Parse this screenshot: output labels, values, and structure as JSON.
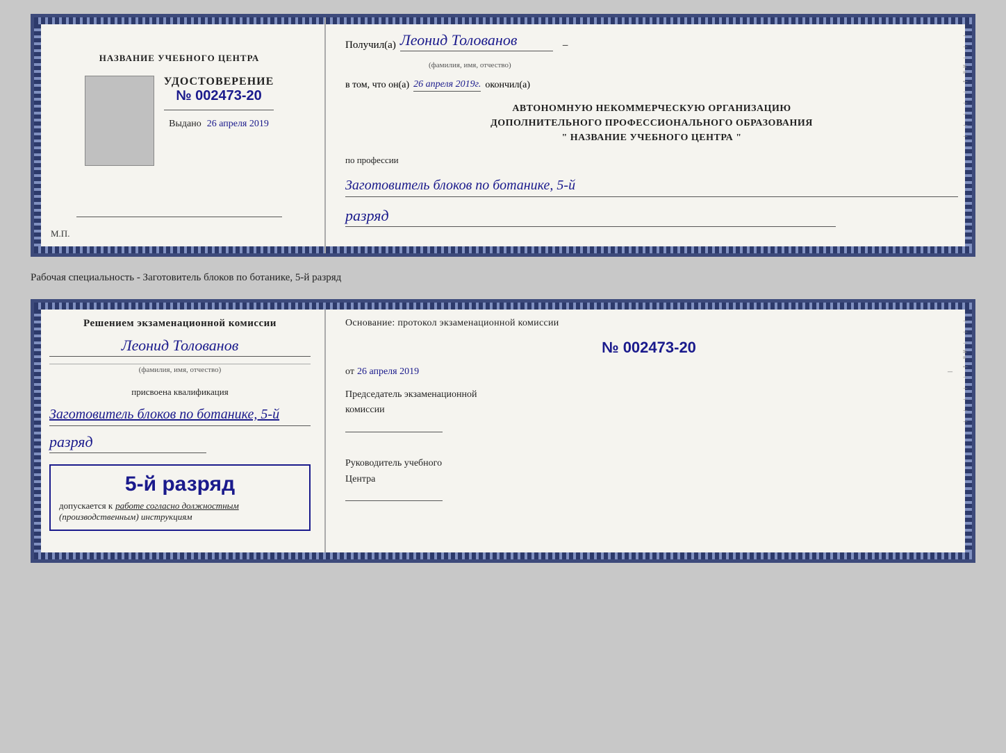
{
  "doc1": {
    "left": {
      "school_name": "НАЗВАНИЕ УЧЕБНОГО ЦЕНТРА",
      "udostoverenie_title": "УДОСТОВЕРЕНИЕ",
      "number": "№ 002473-20",
      "vydano_label": "Выдано",
      "vydano_date": "26 апреля 2019",
      "mp": "М.П."
    },
    "right": {
      "poluchil_label": "Получил(а)",
      "recipient_name": "Леонид Толованов",
      "fio_hint": "(фамилия, имя, отчество)",
      "vtom_label": "в том, что он(а)",
      "okончил_date": "26 апреля 2019г.",
      "okoncil_label": "окончил(а)",
      "org_line1": "АВТОНОМНУЮ НЕКОММЕРЧЕСКУЮ ОРГАНИЗАЦИЮ",
      "org_line2": "ДОПОЛНИТЕЛЬНОГО ПРОФЕССИОНАЛЬНОГО ОБРАЗОВАНИЯ",
      "org_name": "\" НАЗВАНИЕ УЧЕБНОГО ЦЕНТРА \"",
      "po_professii": "по профессии",
      "professiya": "Заготовитель блоков по ботанике, 5-й",
      "razryad": "разряд"
    }
  },
  "specialty_label": "Рабочая специальность - Заготовитель блоков по ботанике, 5-й разряд",
  "doc2": {
    "left": {
      "resheniem_title": "Решением экзаменационной комиссии",
      "name": "Леонид Толованов",
      "fio_hint": "(фамилия, имя, отчество)",
      "prisvoena": "присвоена квалификация",
      "qualification": "Заготовитель блоков по ботанике, 5-й",
      "razryad": "разряд",
      "stamp_rank": "5-й разряд",
      "dopuskaetsya": "допускается к",
      "dopuskaetsya_work": "работе согласно должностным",
      "dopuskaetsya_instruktsii": "(производственным) инструкциям"
    },
    "right": {
      "osnovanie": "Основание: протокол экзаменационной комиссии",
      "protocol_num": "№ 002473-20",
      "ot_label": "от",
      "ot_date": "26 апреля 2019",
      "predsedatel_title": "Председатель экзаменационной",
      "predsedatel_subtitle": "комиссии",
      "rukovoditel_title": "Руководитель учебного",
      "rukovoditel_subtitle": "Центра"
    }
  },
  "icons": {
    "dash": "–"
  }
}
